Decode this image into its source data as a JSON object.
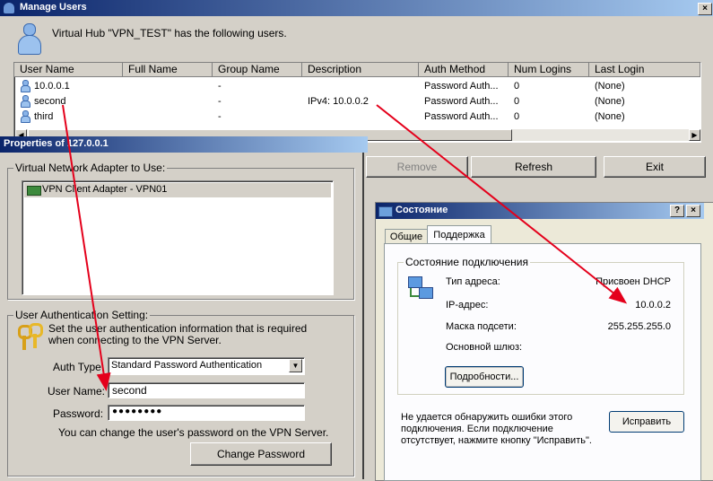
{
  "manage_users": {
    "title": "Manage Users",
    "description": "Virtual Hub \"VPN_TEST\" has the following users.",
    "columns": [
      "User Name",
      "Full Name",
      "Group Name",
      "Description",
      "Auth Method",
      "Num Logins",
      "Last Login"
    ],
    "rows": [
      {
        "user": "10.0.0.1",
        "full": "",
        "group": "-",
        "desc": "",
        "auth": "Password Auth...",
        "logins": "0",
        "last": "(None)"
      },
      {
        "user": "second",
        "full": "",
        "group": "-",
        "desc": "IPv4: 10.0.0.2",
        "auth": "Password Auth...",
        "logins": "0",
        "last": "(None)"
      },
      {
        "user": "third",
        "full": "",
        "group": "-",
        "desc": "",
        "auth": "Password Auth...",
        "logins": "0",
        "last": "(None)"
      }
    ],
    "buttons": {
      "remove": "Remove",
      "refresh": "Refresh",
      "exit": "Exit"
    }
  },
  "properties": {
    "title": "Properties of 127.0.0.1",
    "adapter_group": "Virtual Network Adapter to Use:",
    "adapter_item": "VPN Client Adapter - VPN01",
    "auth_group": "User Authentication Setting:",
    "auth_desc": "Set the user authentication information that is required when connecting to the VPN Server.",
    "auth_type_label": "Auth Type:",
    "auth_type_value": "Standard Password Authentication",
    "username_label": "User Name:",
    "username_value": "second",
    "password_label": "Password:",
    "password_value": "●●●●●●●●",
    "change_note": "You can change the user's password on the VPN Server.",
    "change_button": "Change Password"
  },
  "status": {
    "title": "Состояние",
    "tabs": [
      "Общие",
      "Поддержка"
    ],
    "group": "Состояние подключения",
    "rows": [
      {
        "label": "Тип адреса:",
        "value": "Присвоен DHCP"
      },
      {
        "label": "IP-адрес:",
        "value": "10.0.0.2"
      },
      {
        "label": "Маска подсети:",
        "value": "255.255.255.0"
      },
      {
        "label": "Основной шлюз:",
        "value": ""
      }
    ],
    "details_button": "Подробности...",
    "repair_text": "Не удается обнаружить ошибки этого подключения. Если подключение отсутствует, нажмите кнопку \"Исправить\".",
    "repair_button": "Исправить"
  },
  "annotation_color": "#e4001b"
}
